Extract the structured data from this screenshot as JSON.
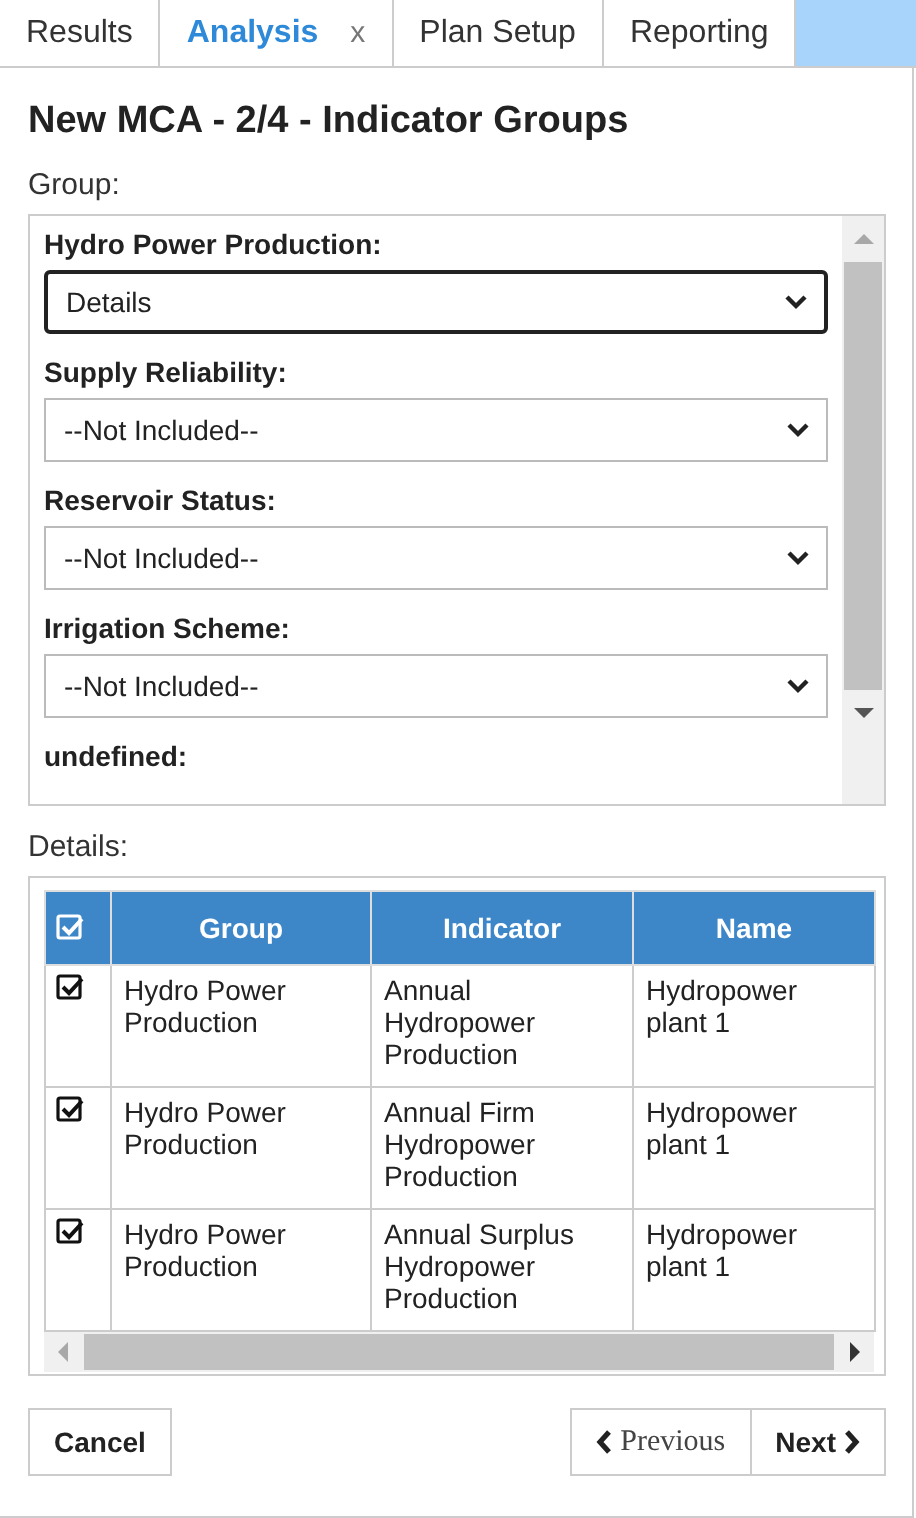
{
  "tabs": [
    {
      "label": "Results",
      "selected": false
    },
    {
      "label": "Analysis",
      "selected": true,
      "close": "x"
    },
    {
      "label": "Plan Setup",
      "selected": false
    },
    {
      "label": "Reporting",
      "selected": false
    }
  ],
  "title": "New MCA - 2/4 - Indicator Groups",
  "group_label": "Group:",
  "groups": [
    {
      "label": "Hydro Power Production:",
      "value": "Details",
      "focused": true
    },
    {
      "label": "Supply Reliability:",
      "value": "--Not Included--",
      "focused": false
    },
    {
      "label": "Reservoir Status:",
      "value": "--Not Included--",
      "focused": false
    },
    {
      "label": "Irrigation Scheme:",
      "value": "--Not Included--",
      "focused": false
    },
    {
      "label": "undefined:"
    }
  ],
  "details_label": "Details:",
  "table": {
    "header_checked": true,
    "columns": [
      "Group",
      "Indicator",
      "Name"
    ],
    "rows": [
      {
        "checked": true,
        "cells": [
          "Hydro Power Production",
          "Annual Hydropower Production",
          "Hydropower plant 1"
        ]
      },
      {
        "checked": true,
        "cells": [
          "Hydro Power Production",
          "Annual Firm Hydropower Production",
          "Hydropower plant 1"
        ]
      },
      {
        "checked": true,
        "cells": [
          "Hydro Power Production",
          "Annual Surplus Hydropower Production",
          "Hydropower plant 1"
        ]
      }
    ]
  },
  "buttons": [
    {
      "kind": "cancel",
      "label": "Cancel"
    },
    {
      "kind": "previous",
      "label": "Previous"
    },
    {
      "kind": "next",
      "label": "Next"
    }
  ]
}
